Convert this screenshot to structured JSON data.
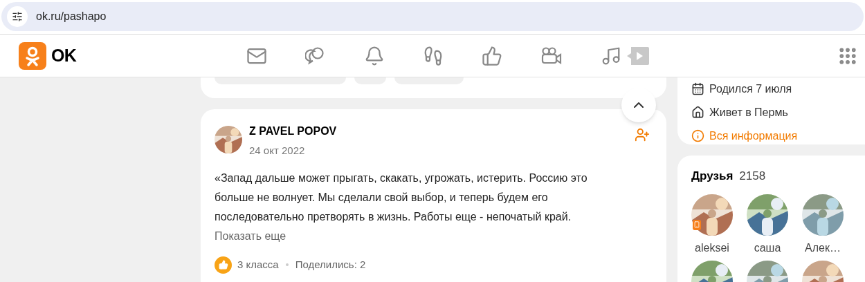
{
  "address_bar": {
    "url": "ok.ru/pashapo"
  },
  "header": {
    "logo_text": "OK"
  },
  "post": {
    "author": "Z PAVEL POPOV",
    "date": "24 окт 2022",
    "text": "«Запад дальше может прыгать, скакать, угрожать, истерить. Россию это больше не волнует. Мы сделали свой выбор, и теперь будем его последовательно претворять в жизнь. Работы еще - непочатый край.",
    "show_more": "Показать еще",
    "likes": "3 класса",
    "shares": "Поделились: 2"
  },
  "about": [
    {
      "kind": "birthday",
      "text": "Родился 7 июля"
    },
    {
      "kind": "city",
      "text": "Живет в Пермь"
    },
    {
      "kind": "link",
      "text": "Вся информация"
    }
  ],
  "friends": {
    "title": "Друзья",
    "count": "2158",
    "items": [
      {
        "name": "aleksei",
        "mobile": true
      },
      {
        "name": "саша",
        "mobile": false
      },
      {
        "name": "Алек…",
        "mobile": false
      }
    ]
  }
}
